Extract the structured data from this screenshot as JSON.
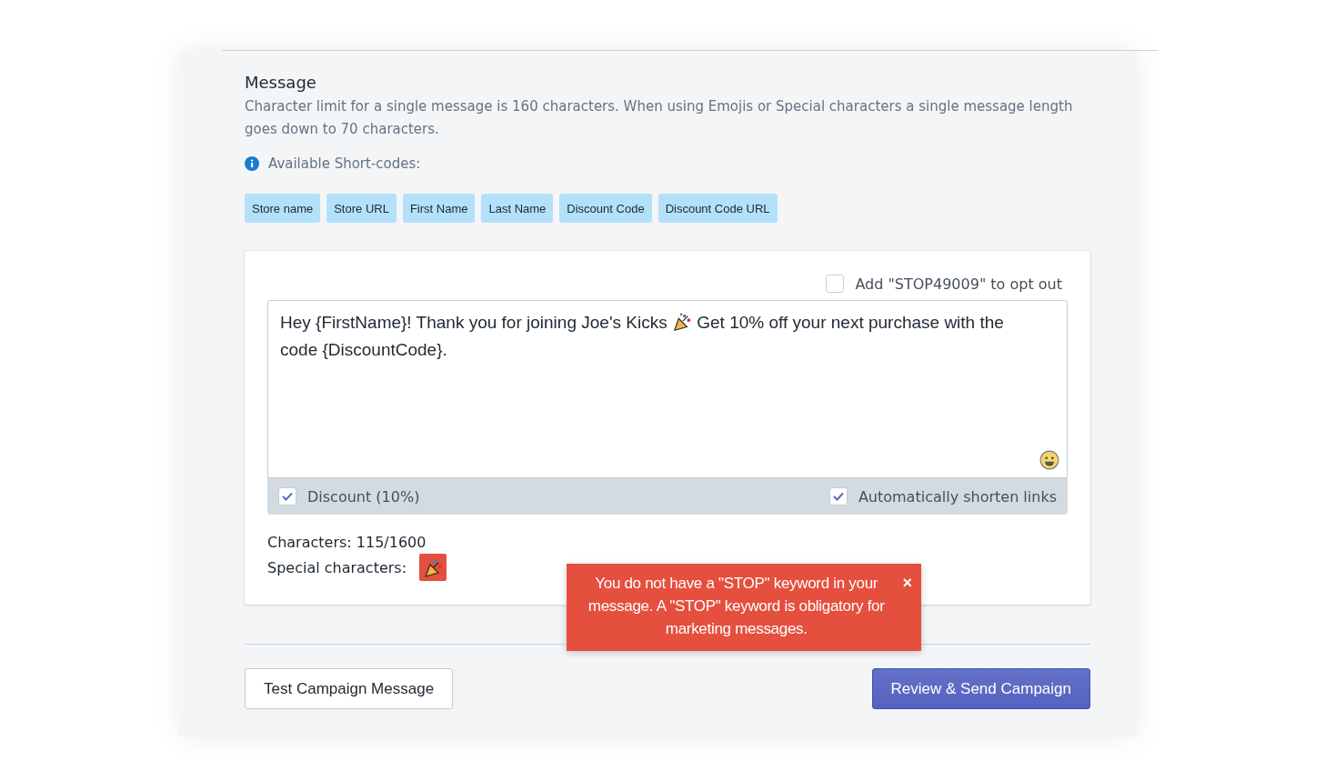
{
  "section": {
    "title": "Message",
    "description": "Character limit for a single message is 160 characters. When using Emojis or Special characters a single message length goes down to 70 characters.",
    "shortcodes_label": "Available Short-codes:"
  },
  "shortcodes": [
    "Store name",
    "Store URL",
    "First Name",
    "Last Name",
    "Discount Code",
    "Discount Code URL"
  ],
  "opt_out": {
    "label": "Add \"STOP49009\" to opt out",
    "checked": false
  },
  "message": {
    "text_before": "Hey {FirstName}! Thank you for joining Joe's Kicks",
    "text_after": "Get 10% off your next purchase with the code {DiscountCode}."
  },
  "options": [
    {
      "label": "Discount (10%)",
      "checked": true
    },
    {
      "label": "Automatically shorten links",
      "checked": true
    }
  ],
  "characters": "Characters: 115/1600",
  "special_label": "Special characters:",
  "toast": {
    "text": "You do not have a \"STOP\" keyword in your message. A \"STOP\" keyword is obligatory for marketing messages.",
    "close": "×"
  },
  "buttons": {
    "test": "Test Campaign Message",
    "send": "Review & Send Campaign"
  }
}
